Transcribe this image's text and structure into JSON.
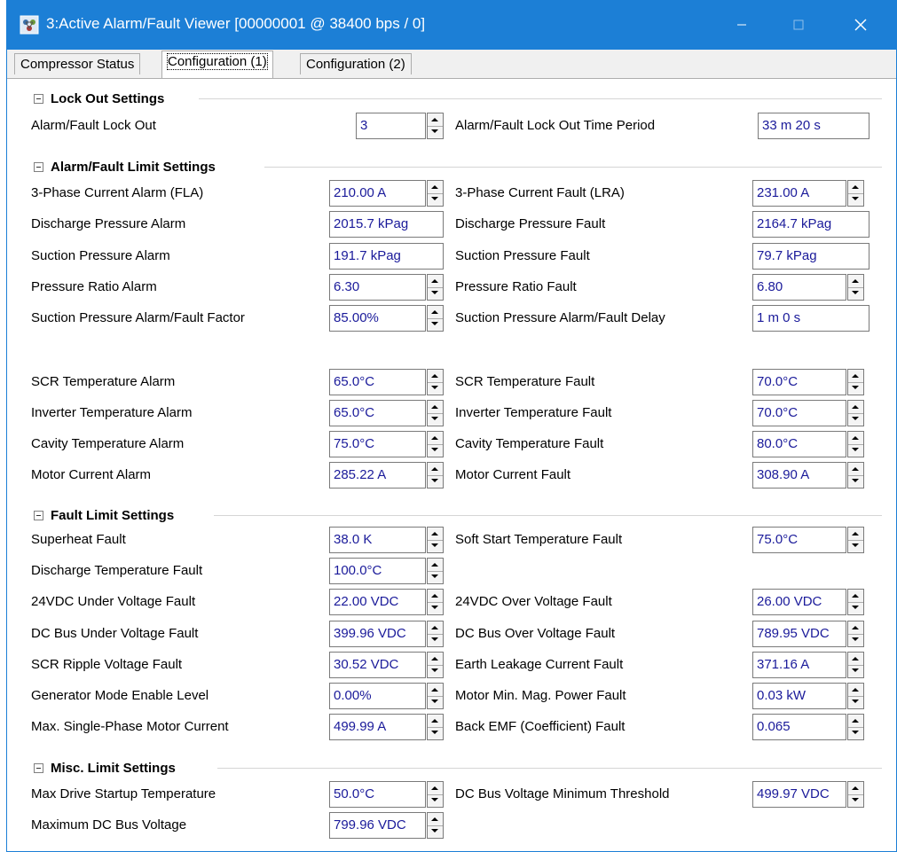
{
  "window": {
    "title": "3:Active Alarm/Fault Viewer [00000001 @ 38400 bps / 0]",
    "icon": "app-network-icon",
    "controls": [
      "minimize-icon",
      "maximize-icon",
      "close-icon"
    ]
  },
  "tabs": [
    {
      "label": "Compressor Status",
      "active": false
    },
    {
      "label": "Configuration (1)",
      "active": true
    },
    {
      "label": "Configuration (2)",
      "active": false
    }
  ],
  "groups": {
    "lockout": {
      "title": "Lock Out Settings",
      "fields": {
        "alarm_fault_lock_out": {
          "label": "Alarm/Fault Lock Out",
          "value": "3"
        },
        "lock_out_time_period": {
          "label": "Alarm/Fault Lock Out Time Period",
          "value": "33 m 20 s"
        }
      }
    },
    "alarm_fault": {
      "title": "Alarm/Fault Limit Settings",
      "fields": {
        "phase3_current_alarm": {
          "label": "3-Phase Current Alarm (FLA)",
          "value": "210.00 A"
        },
        "phase3_current_fault": {
          "label": "3-Phase Current Fault (LRA)",
          "value": "231.00 A"
        },
        "discharge_pressure_alarm": {
          "label": "Discharge Pressure Alarm",
          "value": "2015.7 kPag"
        },
        "discharge_pressure_fault": {
          "label": "Discharge Pressure Fault",
          "value": "2164.7 kPag"
        },
        "suction_pressure_alarm": {
          "label": "Suction Pressure Alarm",
          "value": "191.7 kPag"
        },
        "suction_pressure_fault": {
          "label": "Suction Pressure Fault",
          "value": "79.7 kPag"
        },
        "pressure_ratio_alarm": {
          "label": "Pressure Ratio Alarm",
          "value": "6.30"
        },
        "pressure_ratio_fault": {
          "label": "Pressure Ratio Fault",
          "value": "6.80"
        },
        "suction_factor": {
          "label": "Suction Pressure Alarm/Fault Factor",
          "value": "85.00%"
        },
        "suction_delay": {
          "label": "Suction Pressure Alarm/Fault Delay",
          "value": "1 m 0 s"
        },
        "scr_temp_alarm": {
          "label": "SCR Temperature Alarm",
          "value": "65.0°C"
        },
        "scr_temp_fault": {
          "label": "SCR Temperature Fault",
          "value": "70.0°C"
        },
        "inverter_temp_alarm": {
          "label": "Inverter Temperature Alarm",
          "value": "65.0°C"
        },
        "inverter_temp_fault": {
          "label": "Inverter Temperature Fault",
          "value": "70.0°C"
        },
        "cavity_temp_alarm": {
          "label": "Cavity Temperature Alarm",
          "value": "75.0°C"
        },
        "cavity_temp_fault": {
          "label": "Cavity Temperature Fault",
          "value": "80.0°C"
        },
        "motor_current_alarm": {
          "label": "Motor Current Alarm",
          "value": "285.22 A"
        },
        "motor_current_fault": {
          "label": "Motor Current Fault",
          "value": "308.90 A"
        }
      }
    },
    "fault_limit": {
      "title": "Fault Limit Settings",
      "fields": {
        "superheat_fault": {
          "label": "Superheat Fault",
          "value": "38.0 K"
        },
        "soft_start_temp_fault": {
          "label": "Soft Start Temperature Fault",
          "value": "75.0°C"
        },
        "discharge_temp_fault": {
          "label": "Discharge Temperature Fault",
          "value": "100.0°C"
        },
        "v24_under_voltage": {
          "label": "24VDC Under Voltage Fault",
          "value": "22.00 VDC"
        },
        "v24_over_voltage": {
          "label": "24VDC Over Voltage Fault",
          "value": "26.00 VDC"
        },
        "dc_bus_under_voltage": {
          "label": "DC Bus Under Voltage Fault",
          "value": "399.96 VDC"
        },
        "dc_bus_over_voltage": {
          "label": "DC Bus Over Voltage Fault",
          "value": "789.95 VDC"
        },
        "scr_ripple_voltage": {
          "label": "SCR Ripple Voltage Fault",
          "value": "30.52 VDC"
        },
        "earth_leakage_current": {
          "label": "Earth Leakage Current Fault",
          "value": "371.16 A"
        },
        "generator_mode_level": {
          "label": "Generator Mode Enable Level",
          "value": "0.00%"
        },
        "motor_min_mag_power": {
          "label": "Motor Min. Mag. Power Fault",
          "value": "0.03 kW"
        },
        "max_single_phase_current": {
          "label": "Max. Single-Phase Motor Current",
          "value": "499.99 A"
        },
        "back_emf_fault": {
          "label": "Back EMF (Coefficient) Fault",
          "value": "0.065"
        }
      }
    },
    "misc": {
      "title": "Misc. Limit Settings",
      "fields": {
        "max_drive_startup_temp": {
          "label": "Max Drive Startup Temperature",
          "value": "50.0°C"
        },
        "dc_bus_voltage_min_threshold": {
          "label": "DC Bus Voltage Minimum Threshold",
          "value": "499.97 VDC"
        },
        "max_dc_bus_voltage": {
          "label": "Maximum DC Bus Voltage",
          "value": "799.96 VDC"
        }
      }
    }
  },
  "colors": {
    "titlebar": "#1c7fd6",
    "value_text": "#1a1a9a"
  }
}
